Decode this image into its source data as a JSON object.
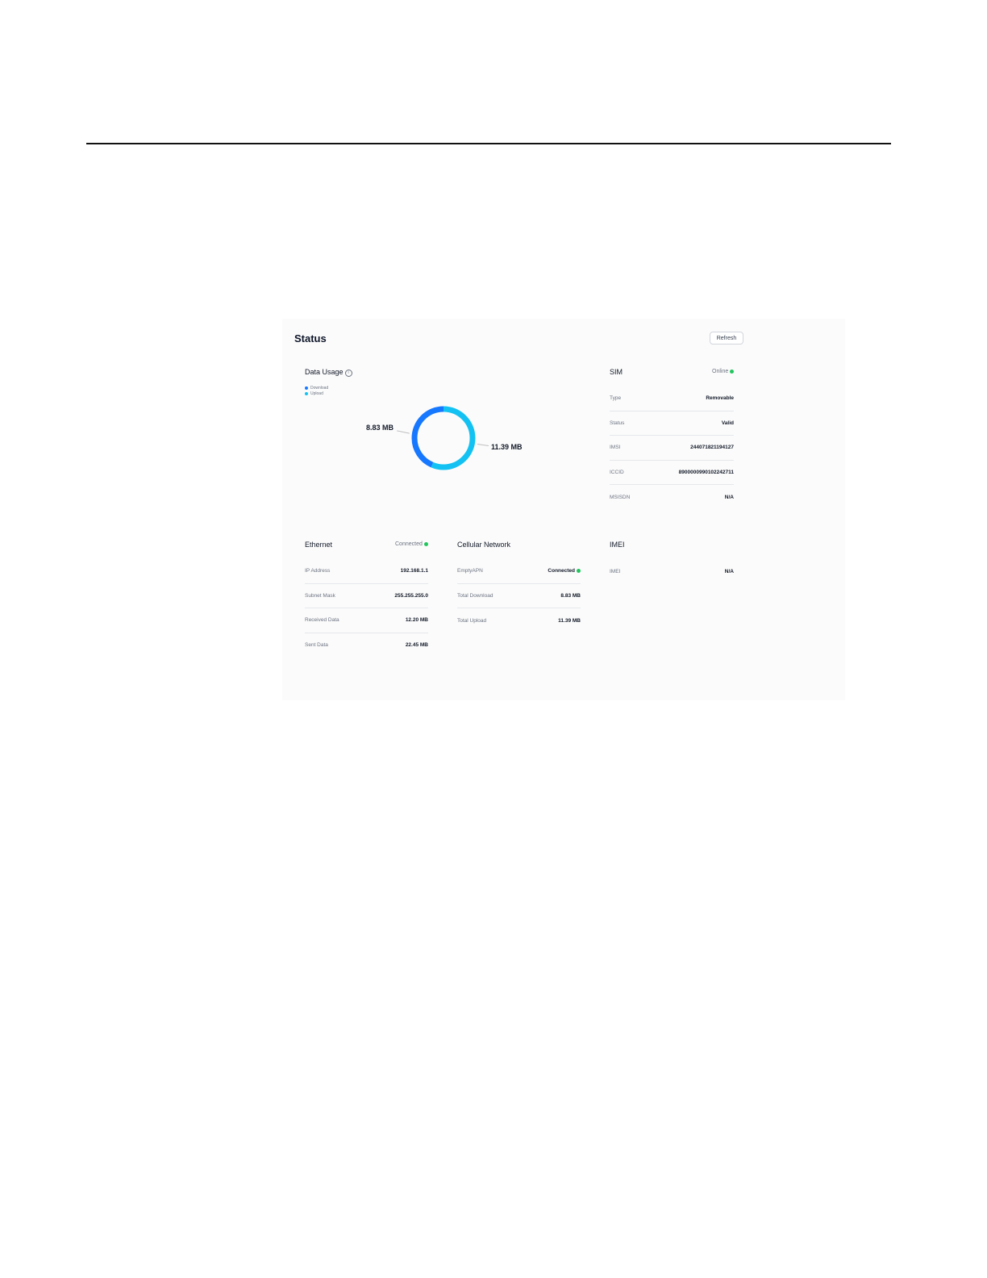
{
  "page": {
    "title": "Status",
    "refresh_label": "Refresh"
  },
  "data_usage": {
    "title": "Data Usage",
    "info_icon": "info-circle-icon",
    "legend": [
      {
        "label": "Download",
        "color": "#1677ff"
      },
      {
        "label": "Upload",
        "color": "#13c2f2"
      }
    ],
    "download_value": "8.83 MB",
    "upload_value": "11.39 MB",
    "download_mb": 8.83,
    "upload_mb": 11.39
  },
  "sim": {
    "title": "SIM",
    "status": "Online",
    "rows": [
      {
        "key": "Type",
        "value": "Removable"
      },
      {
        "key": "Status",
        "value": "Valid"
      },
      {
        "key": "IMSI",
        "value": "244071821194127"
      },
      {
        "key": "ICCID",
        "value": "8900000990102242711"
      },
      {
        "key": "MSISDN",
        "value": "N/A"
      }
    ]
  },
  "ethernet": {
    "title": "Ethernet",
    "status": "Connected",
    "rows": [
      {
        "key": "IP Address",
        "value": "192.168.1.1"
      },
      {
        "key": "Subnet Mask",
        "value": "255.255.255.0"
      },
      {
        "key": "Received Data",
        "value": "12.20 MB"
      },
      {
        "key": "Sent Data",
        "value": "22.45 MB"
      }
    ]
  },
  "cellular": {
    "title": "Cellular Network",
    "rows": [
      {
        "key": "EmptyAPN",
        "value": "Connected"
      },
      {
        "key": "Total Download",
        "value": "8.83 MB"
      },
      {
        "key": "Total Upload",
        "value": "11.39 MB"
      }
    ]
  },
  "imei": {
    "title": "IMEI",
    "rows": [
      {
        "key": "IMEI",
        "value": "N/A"
      }
    ]
  },
  "colors": {
    "download": "#1677ff",
    "upload": "#13c2f2",
    "online": "#22c55e"
  }
}
